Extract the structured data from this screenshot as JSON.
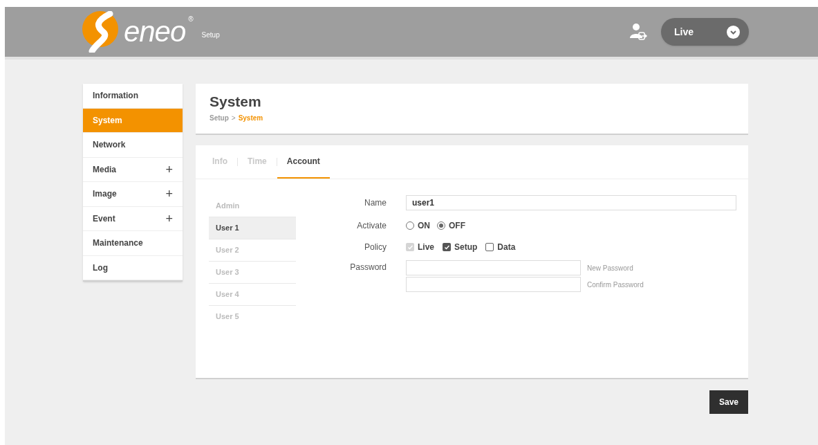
{
  "header": {
    "logo": {
      "wordmark": "eneo",
      "registered": "®",
      "subtitle": "Setup"
    },
    "mode_select": {
      "value": "Live"
    }
  },
  "sidebar": {
    "items": [
      {
        "label": "Information",
        "selected": false
      },
      {
        "label": "System",
        "selected": true
      },
      {
        "label": "Network",
        "selected": false
      },
      {
        "label": "Media",
        "selected": false,
        "expand_symbol": "+"
      },
      {
        "label": "Image",
        "selected": false,
        "expand_symbol": "+"
      },
      {
        "label": "Event",
        "selected": false,
        "expand_symbol": "+"
      },
      {
        "label": "Maintenance",
        "selected": false
      },
      {
        "label": "Log",
        "selected": false
      }
    ]
  },
  "page": {
    "title": "System",
    "breadcrumb": [
      "Setup",
      "System"
    ],
    "breadcrumb_separator": ">"
  },
  "tabs": [
    {
      "label": "Info",
      "selected": false
    },
    {
      "label": "Time",
      "selected": false
    },
    {
      "label": "Account",
      "selected": true
    }
  ],
  "users": [
    {
      "label": "Admin",
      "selected": false
    },
    {
      "label": "User 1",
      "selected": true
    },
    {
      "label": "User 2",
      "selected": false
    },
    {
      "label": "User 3",
      "selected": false
    },
    {
      "label": "User 4",
      "selected": false
    },
    {
      "label": "User 5",
      "selected": false
    }
  ],
  "form": {
    "name": {
      "label": "Name",
      "value": "user1"
    },
    "activate": {
      "label": "Activate",
      "options": [
        {
          "label": "ON",
          "selected": false
        },
        {
          "label": "OFF",
          "selected": true
        }
      ]
    },
    "policy": {
      "label": "Policy",
      "options": [
        {
          "label": "Live",
          "checked": true,
          "disabled": true
        },
        {
          "label": "Setup",
          "checked": true,
          "disabled": false
        },
        {
          "label": "Data",
          "checked": false,
          "disabled": false
        }
      ]
    },
    "password": {
      "label": "Password",
      "fields": [
        {
          "hint": "New Password"
        },
        {
          "hint": "Confirm Password"
        }
      ]
    }
  },
  "save_button": "Save"
}
